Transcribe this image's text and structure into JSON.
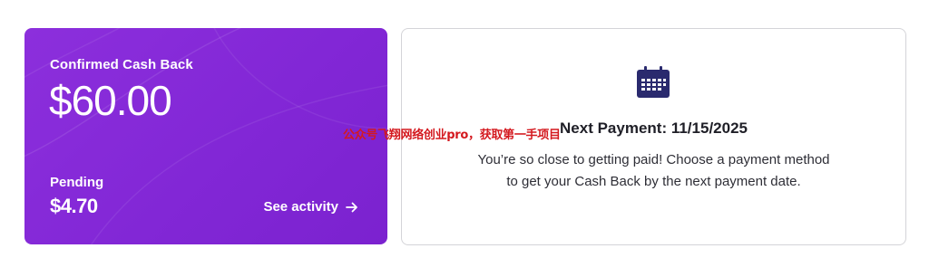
{
  "cash_back_card": {
    "confirmed_label": "Confirmed Cash Back",
    "confirmed_amount": "$60.00",
    "pending_label": "Pending",
    "pending_amount": "$4.70",
    "see_activity_label": "See activity",
    "see_activity_icon": "arrow-right-icon",
    "background_color": "#8a2be2"
  },
  "payment_card": {
    "icon": "calendar-icon",
    "icon_color": "#2a2a6e",
    "title": "Next Payment: 11/15/2025",
    "description": "You’re so close to getting paid! Choose a payment method to get your Cash Back by the next payment date."
  },
  "watermark": {
    "text": "公众号飞翔网络创业pro，获取第一手项目",
    "color": "#d4191f"
  }
}
